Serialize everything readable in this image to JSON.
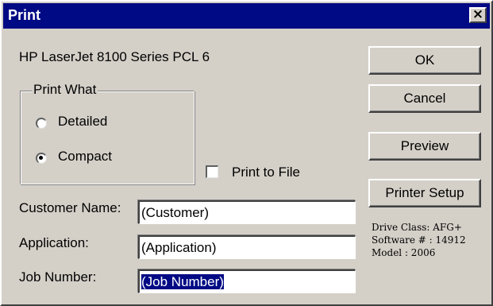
{
  "window": {
    "title": "Print",
    "close_glyph": "×"
  },
  "printer_name": "HP LaserJet 8100 Series PCL 6",
  "print_what": {
    "legend": "Print What",
    "options": [
      {
        "label": "Detailed",
        "selected": false
      },
      {
        "label": "Compact",
        "selected": true
      }
    ]
  },
  "print_to_file": {
    "label": "Print to File",
    "checked": false
  },
  "fields": {
    "customer_name": {
      "label": "Customer Name:",
      "value": "(Customer)"
    },
    "application": {
      "label": "Application:",
      "value": "(Application)"
    },
    "job_number": {
      "label": "Job Number:",
      "value": "(Job Number)"
    }
  },
  "buttons": {
    "ok": "OK",
    "cancel": "Cancel",
    "preview": "Preview",
    "printer_setup": "Printer Setup"
  },
  "info": {
    "drive_class": "Drive Class: AFG+",
    "software_number": "Software # : 14912",
    "model": "Model : 2006"
  },
  "colors": {
    "titlebar": "#000a84",
    "face": "#d4d0c8",
    "selection": "#000a84"
  },
  "icons": {
    "close": "close-icon",
    "radio": "radio-button",
    "checkbox": "checkbox"
  }
}
